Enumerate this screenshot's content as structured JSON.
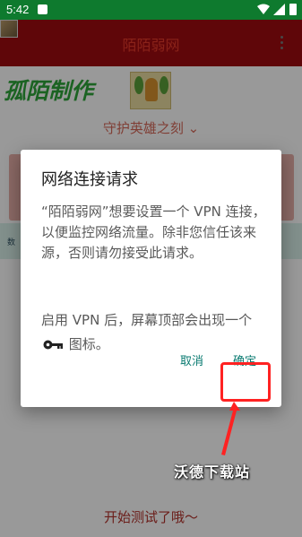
{
  "status_bar": {
    "time": "5:42"
  },
  "app_bar": {
    "title": "陌陌弱网"
  },
  "app": {
    "brand": "孤陌制作",
    "subtitle": "守护英雄之刻 ⌄",
    "side_text": "数",
    "start_text": "开始测试了哦～"
  },
  "dialog": {
    "title": "网络连接请求",
    "message": "“陌陌弱网”想要设置一个 VPN 连接，以便监控网络流量。除非您信任该来源，否则请勿接受此请求。",
    "note_before": "启用 VPN 后，屏幕顶部会出现一个",
    "note_after": "图标。",
    "cancel_label": "取消",
    "ok_label": "确定"
  },
  "annotation": {
    "watermark": "沃德下载站",
    "highlight_color": "#ff2222"
  },
  "icons": {
    "key": "key-icon",
    "wifi": "wifi-icon",
    "cell": "cellular-icon",
    "battery": "battery-icon"
  }
}
